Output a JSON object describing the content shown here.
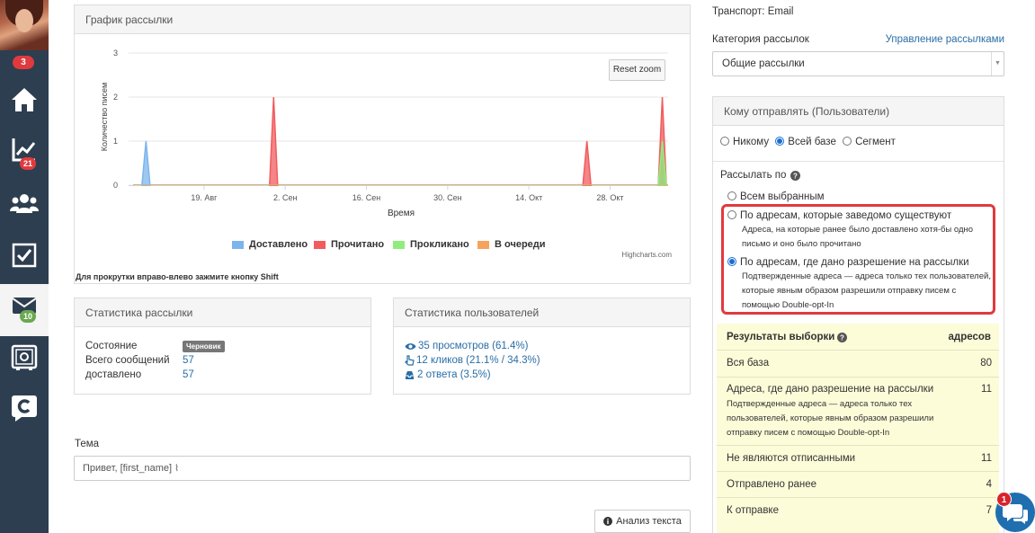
{
  "sidebar": {
    "avatar_badge": "3",
    "items": [
      {
        "name": "home-icon",
        "badge": ""
      },
      {
        "name": "chart-icon",
        "badge": "21"
      },
      {
        "name": "users-icon",
        "badge": ""
      },
      {
        "name": "checkbox-icon",
        "badge": ""
      },
      {
        "name": "mail-icon",
        "badge": "10"
      },
      {
        "name": "safe-icon",
        "badge": ""
      },
      {
        "name": "chat-logo-icon",
        "badge": ""
      }
    ]
  },
  "chart_panel": {
    "title": "График рассылки",
    "reset_zoom": "Reset zoom",
    "credits": "Highcharts.com",
    "hint": "Для прокрутки вправо-влево зажмите кнопку Shift"
  },
  "chart_data": {
    "type": "area",
    "ylabel": "Количество писем",
    "xlabel": "Время",
    "ylim": [
      0,
      3
    ],
    "yticks": [
      "0",
      "1",
      "2",
      "3"
    ],
    "xticks": [
      "19. Авг",
      "2. Сен",
      "16. Сен",
      "30. Сен",
      "14. Окт",
      "28. Окт"
    ],
    "series": [
      {
        "name": "Доставлено",
        "color": "#7cb5ec",
        "points": [
          {
            "x": "2021-08-09",
            "y": 1
          },
          {
            "x": "2021-11-06",
            "y": 1
          }
        ]
      },
      {
        "name": "Прочитано",
        "color": "#f15c5f",
        "points": [
          {
            "x": "2021-08-31",
            "y": 2
          },
          {
            "x": "2021-10-24",
            "y": 1
          },
          {
            "x": "2021-11-06",
            "y": 2
          }
        ]
      },
      {
        "name": "Прокликано",
        "color": "#90ed7d",
        "points": [
          {
            "x": "2021-11-06",
            "y": 1
          }
        ]
      },
      {
        "name": "В очереди",
        "color": "#f7a35c",
        "points": []
      }
    ],
    "legend": [
      "Доставлено",
      "Прочитано",
      "Прокликано",
      "В очереди"
    ],
    "legend_position": "bottom",
    "grid": true
  },
  "mailing_stats": {
    "title": "Статистика рассылки",
    "rows": [
      {
        "label": "Состояние",
        "value": "Черновик"
      },
      {
        "label": "Всего сообщений",
        "value": "57"
      },
      {
        "label": "доставлено",
        "value": "57"
      }
    ]
  },
  "user_stats": {
    "title": "Статистика пользователей",
    "views": "35 просмотров (61.4%)",
    "clicks": "12 кликов (21.1% / 34.3%)",
    "replies": "2 ответа (3.5%)"
  },
  "subject": {
    "label": "Тема",
    "value": "Привет, [first_name]"
  },
  "analyze_button": "Анализ текста",
  "right": {
    "transport": "Транспорт: Email",
    "category_label": "Категория рассылок",
    "manage_link": "Управление рассылками",
    "category_value": "Общие рассылки",
    "recipients_title": "Кому отправлять (Пользователи)",
    "recipient_options": [
      "Никому",
      "Всей базе",
      "Сегмент"
    ],
    "send_by_label": "Рассылать по",
    "send_options": [
      {
        "label": "Всем выбранным",
        "desc": ""
      },
      {
        "label": "По адресам, которые заведомо существуют",
        "desc_lines": [
          "Адреса, на которые ранее было доставлено хотя-бы одно",
          "письмо и оно было прочитано"
        ]
      },
      {
        "label": "По адресам, где дано разрешение на рассылки",
        "desc_lines": [
          "Подтвержденные адреса — адреса только тех пользователей,",
          "которые явным образом разрешили отправку писем с",
          "помощью Double-opt-In"
        ]
      }
    ],
    "results_title": "Результаты выборки",
    "results_col": "адресов",
    "results": [
      {
        "label": "Вся база",
        "value": "80"
      },
      {
        "label": "Адреса, где дано разрешение на рассылки",
        "value": "11",
        "desc_lines": [
          "Подтвержденные адреса — адреса только тех",
          "пользователей, которые явным образом разрешили",
          "отправку писем с помощью Double-opt-In"
        ]
      },
      {
        "label": "Не являются отписанными",
        "value": "11"
      },
      {
        "label": "Отправлено ранее",
        "value": "4"
      },
      {
        "label": "К отправке",
        "value": "7"
      }
    ]
  },
  "chat_badge": "1",
  "colors": {
    "sidebar": "#2d3e50",
    "highlight": "#e03a3e",
    "link": "#2a6ea6",
    "results_bg": "#fcfcd9"
  }
}
